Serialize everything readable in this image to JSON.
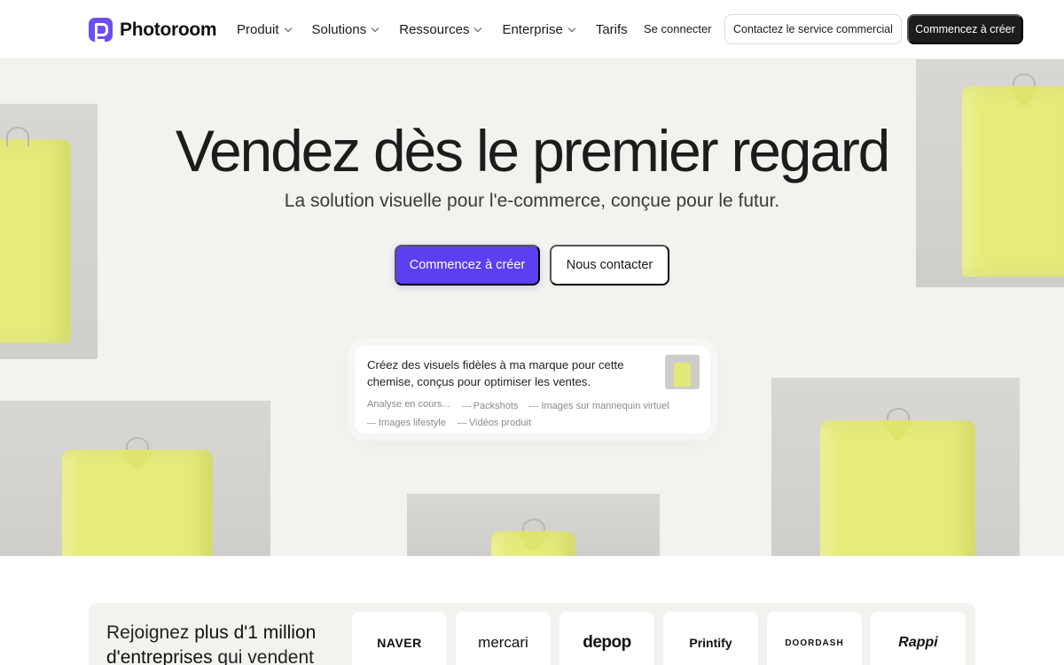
{
  "brand": {
    "name": "Photoroom",
    "accent": "#5b3ff0"
  },
  "nav": {
    "items": [
      {
        "label": "Produit",
        "dropdown": true
      },
      {
        "label": "Solutions",
        "dropdown": true
      },
      {
        "label": "Ressources",
        "dropdown": true
      },
      {
        "label": "Enterprise",
        "dropdown": true
      },
      {
        "label": "Tarifs",
        "dropdown": false
      }
    ],
    "signin": "Se connecter",
    "contact_sales": "Contactez le service commercial",
    "start": "Commencez à créer"
  },
  "hero": {
    "title": "Vendez dès le premier regard",
    "subtitle": "La solution visuelle pour l'e-commerce, conçue pour le futur.",
    "primary_cta": "Commencez à créer",
    "secondary_cta": "Nous contacter"
  },
  "prompt": {
    "text": "Créez des visuels fidèles à ma marque pour cette chemise, conçus pour optimiser les ventes.",
    "tags": [
      "Analyse en cours...",
      "Packshots",
      "Images sur mannequin virtuel",
      "Images lifestyle",
      "Vidéos produit"
    ]
  },
  "social": {
    "join_prefix": "Rejoignez ",
    "join_bold": "plus d'1 million d'entreprises",
    "join_suffix": " qui vendent",
    "logos": [
      "NAVER",
      "mercari",
      "depop",
      "Printify",
      "DOORDASH",
      "Rappi"
    ]
  }
}
